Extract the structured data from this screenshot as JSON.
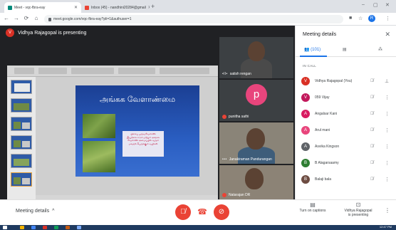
{
  "browser": {
    "tabs": [
      {
        "label": "Meet - vqc-fbra-eay",
        "active": true,
        "favicon_color": "#00897b"
      },
      {
        "label": "Inbox (45) - nandhini20284@gmail",
        "active": false,
        "favicon_color": "#ea4335"
      }
    ],
    "url": "meet.google.com/vqc-fbra-eay?pli=1&authuser=1",
    "profile_initial": "R"
  },
  "meet": {
    "presenter_initial": "V",
    "presenting_text": "Vidhya Rajagopal is presenting",
    "slide": {
      "title": "அங்கக வேளாண்மை",
      "lines": [
        "பிசைப் பருவவேளாண்",
        "இயற்கை உரம் மற்றும் அங்கக",
        "வேளாண் அமைப்பில் வரும்",
        "மகசூல் பெருக்கும் வழிகள்"
      ]
    },
    "tiles": [
      {
        "name": "satish rengan",
        "type": "video",
        "muted": false
      },
      {
        "name": "punitha sathi",
        "type": "avatar",
        "initial": "p",
        "color": "#e8457c",
        "muted": true
      },
      {
        "name": "Janakiraman Pandurangan",
        "type": "video",
        "muted": false
      },
      {
        "name": "Natarajan DR",
        "type": "video",
        "muted": true
      }
    ],
    "bottom": {
      "meeting_details_label": "Meeting details",
      "captions_label": "Turn on captions",
      "presenting_label_line1": "Vidhya Rajagopal",
      "presenting_label_line2": "is presenting"
    }
  },
  "panel": {
    "title": "Meeting details",
    "people_count": "(101)",
    "section_label": "IN CALL",
    "participants": [
      {
        "name": "Vidhya Rajagopal (You)",
        "initial": "V",
        "color": "#d93025"
      },
      {
        "name": "059 Vijay",
        "initial": "V",
        "color": "#c2185b"
      },
      {
        "name": "Angalsar Kani",
        "initial": "A",
        "color": "#d81b60"
      },
      {
        "name": "Arul mani",
        "initial": "A",
        "color": "#e8457c"
      },
      {
        "name": "Asvika Kingson",
        "initial": "A",
        "color": "#5f6368"
      },
      {
        "name": "B Alagarsaamy",
        "initial": "B",
        "color": "#2e7d32"
      },
      {
        "name": "Balaji bala",
        "initial": "B",
        "color": "#6d4c41"
      }
    ]
  },
  "taskbar": {
    "time": "12:47 PM"
  }
}
